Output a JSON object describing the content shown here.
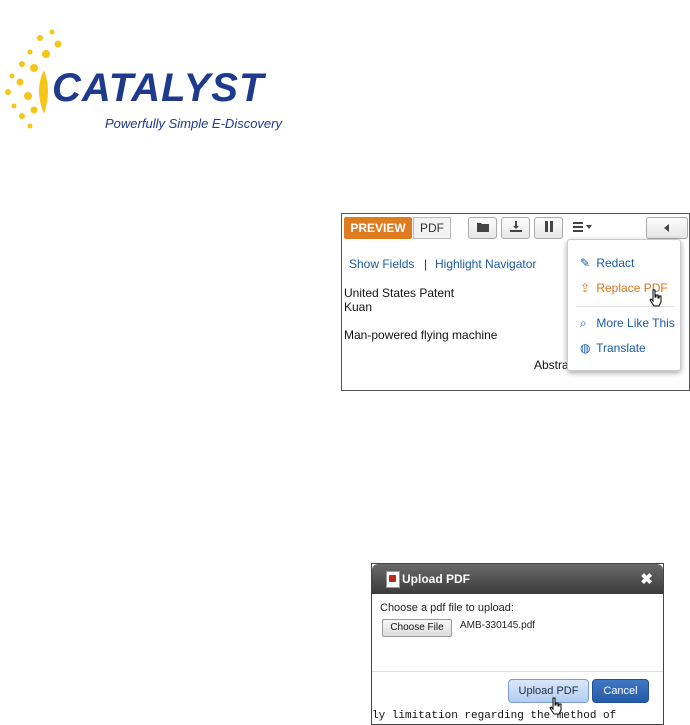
{
  "logo": {
    "word": "CATALYST",
    "tagline": "Powerfully Simple E-Discovery",
    "brand_color": "#1e3a8c",
    "sun_color": "#f5c518"
  },
  "viewer": {
    "tabs": {
      "preview": "PREVIEW",
      "pdf": "PDF"
    },
    "toolbar_icons": [
      "folder-icon",
      "download-icon",
      "pause-icon",
      "menu-icon",
      "collapse-left-icon"
    ],
    "links": {
      "show_fields": "Show Fields",
      "separator": "|",
      "highlight_navigator": "Highlight Navigator"
    },
    "document": {
      "line1": "United States Patent",
      "line2": "Kuan",
      "line3": "Man-powered flying machine",
      "abstract_partial": "Abstra"
    },
    "accent_color": "#e07b1f"
  },
  "menu": {
    "items": [
      {
        "label": "Redact",
        "icon": "edit-icon"
      },
      {
        "label": "Replace PDF",
        "icon": "upload-icon"
      },
      {
        "label": "More Like This",
        "icon": "search-icon"
      },
      {
        "label": "Translate",
        "icon": "globe-icon"
      }
    ]
  },
  "dialog": {
    "title": "Upload PDF",
    "close_symbol": "✖",
    "prompt": "Choose a pdf file to upload:",
    "choose_label": "Choose File",
    "file_name": "AMB-330145.pdf",
    "upload_label": "Upload PDF",
    "cancel_label": "Cancel",
    "background_text": "ly limitation regarding the method of"
  }
}
